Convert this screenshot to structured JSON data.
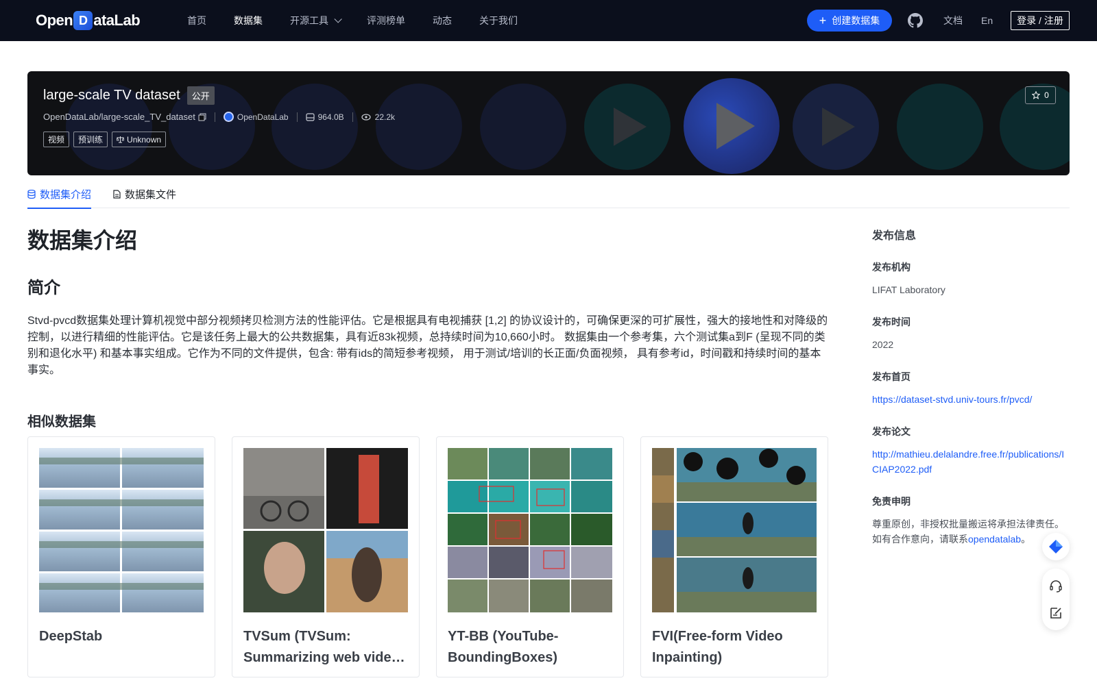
{
  "nav": {
    "logo_text_a": "Open",
    "logo_text_b": "D",
    "logo_text_c": "ataLab",
    "items": [
      {
        "label": "首页"
      },
      {
        "label": "数据集"
      },
      {
        "label": "开源工具"
      },
      {
        "label": "评测榜单"
      },
      {
        "label": "动态"
      },
      {
        "label": "关于我们"
      }
    ],
    "create_label": "创建数据集",
    "docs_label": "文档",
    "lang_label": "En",
    "login_label": "登录 / 注册"
  },
  "dataset": {
    "title": "large-scale TV dataset",
    "visibility": "公开",
    "path": "OpenDataLab/large-scale_TV_dataset",
    "org": "OpenDataLab",
    "size": "964.0B",
    "views": "22.2k",
    "tags": [
      "视频",
      "预训练"
    ],
    "license": "Unknown",
    "stars": "0"
  },
  "tabs": [
    {
      "label": "数据集介绍",
      "icon": "database-icon"
    },
    {
      "label": "数据集文件",
      "icon": "file-icon"
    }
  ],
  "intro": {
    "heading": "数据集介绍",
    "subheading": "简介",
    "description": "Stvd-pvcd数据集处理计算机视觉中部分视频拷贝检测方法的性能评估。它是根据具有电视捕获 [1,2] 的协议设计的，可确保更深的可扩展性，强大的接地性和对降级的控制，以进行精细的性能评估。它是该任务上最大的公共数据集，具有近83k视频，总持续时间为10,660小时。 数据集由一个参考集，六个测试集a到F (呈现不同的类别和退化水平) 和基本事实组成。它作为不同的文件提供，包含: 带有ids的简短参考视频， 用于测试/培训的长正面/负面视频， 具有参考id，时间戳和持续时间的基本事实。",
    "similar_heading": "相似数据集"
  },
  "similar": [
    {
      "title": "DeepStab"
    },
    {
      "title": "TVSum (TVSum: Summarizing web videos using titles)"
    },
    {
      "title": "YT-BB (YouTube-BoundingBoxes)"
    },
    {
      "title": "FVI(Free-form Video Inpainting)"
    }
  ],
  "sidebar": {
    "heading": "发布信息",
    "org_label": "发布机构",
    "org_value": "LIFAT Laboratory",
    "time_label": "发布时间",
    "time_value": "2022",
    "home_label": "发布首页",
    "home_value": "https://dataset-stvd.univ-tours.fr/pvcd/",
    "paper_label": "发布论文",
    "paper_value": "http://mathieu.delalandre.free.fr/publications/ICIAP2022.pdf",
    "disclaimer_label": "免责申明",
    "disclaimer_text": "尊重原创，非授权批量搬运将承担法律责任。如有合作意向，请联系",
    "disclaimer_link": "opendatalab",
    "disclaimer_end": "。"
  },
  "colors": {
    "accent": "#1e5df7",
    "nav_bg": "#0b0f1c",
    "banner_bg": "#101114"
  }
}
